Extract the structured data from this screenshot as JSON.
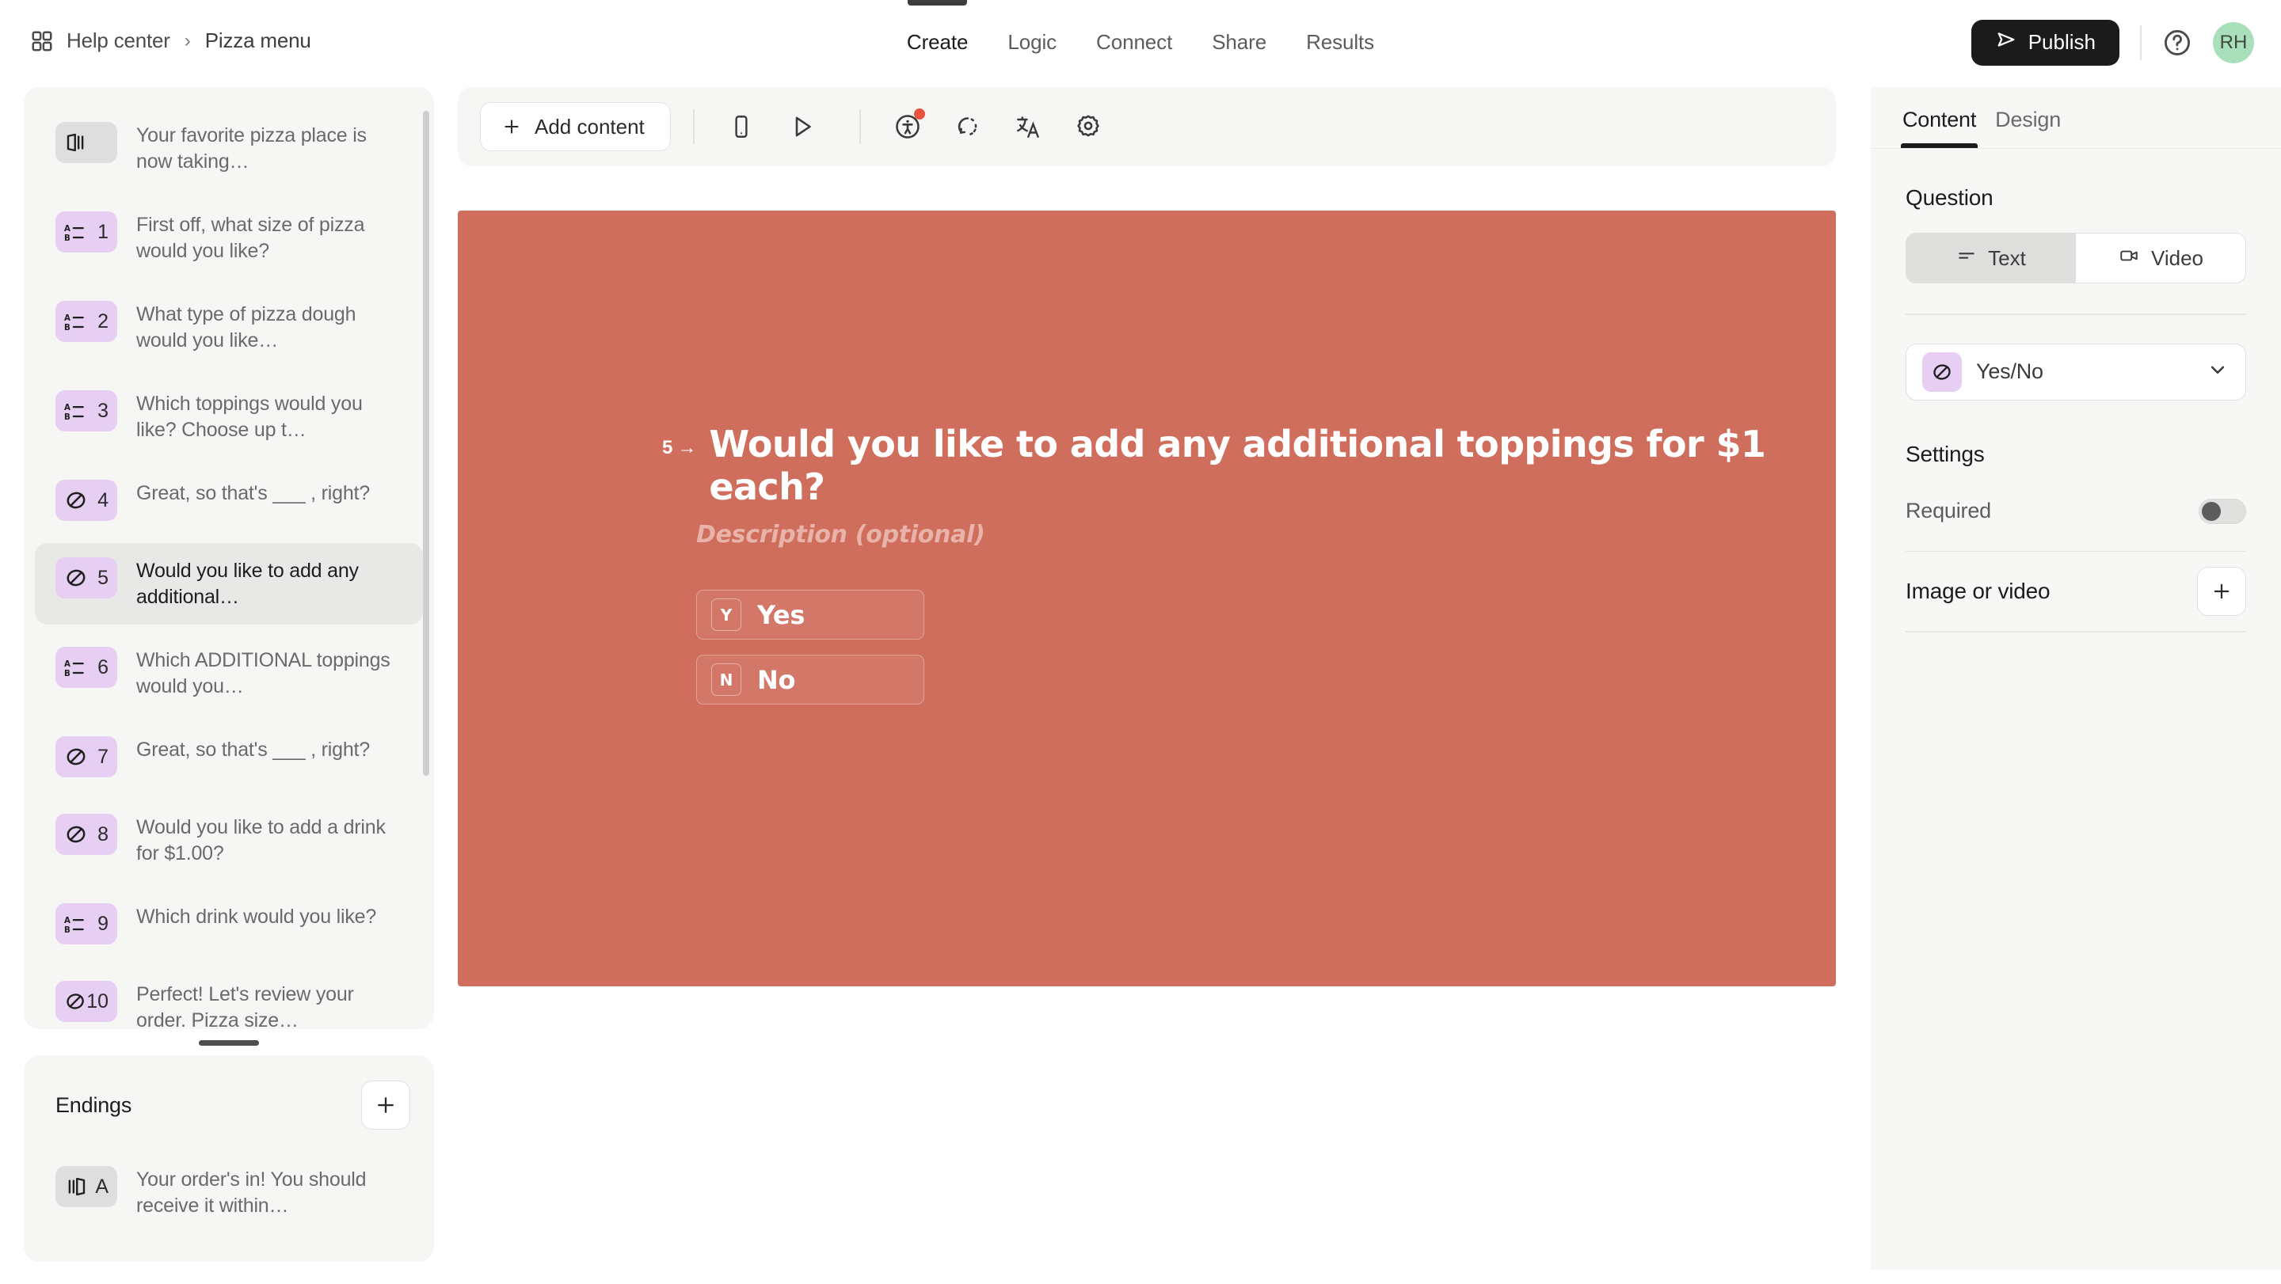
{
  "topbar": {
    "grid_icon": "grid-icon",
    "breadcrumb_root": "Help center",
    "breadcrumb_separator": "›",
    "breadcrumb_current": "Pizza menu",
    "tabs": [
      {
        "label": "Create",
        "active": true
      },
      {
        "label": "Logic",
        "active": false
      },
      {
        "label": "Connect",
        "active": false
      },
      {
        "label": "Share",
        "active": false
      },
      {
        "label": "Results",
        "active": false
      }
    ],
    "publish_label": "Publish",
    "publish_icon": "send-icon",
    "help_icon": "question-circle-icon",
    "avatar_initials": "RH",
    "avatar_color": "#a9e0bb"
  },
  "sidebar": {
    "questions": [
      {
        "badge_type": "welcome",
        "number": "",
        "label": "Your favorite pizza place is now taking…",
        "selected": false
      },
      {
        "badge_type": "multiple-choice",
        "number": "1",
        "label": "First off, what size of pizza would you like?",
        "selected": false
      },
      {
        "badge_type": "multiple-choice",
        "number": "2",
        "label": "What type of pizza dough would you like…",
        "selected": false
      },
      {
        "badge_type": "multiple-choice",
        "number": "3",
        "label": "Which toppings would you like? Choose up t…",
        "selected": false
      },
      {
        "badge_type": "yes-no",
        "number": "4",
        "label": "Great, so that's ___ , right?",
        "selected": false
      },
      {
        "badge_type": "yes-no",
        "number": "5",
        "label": "Would you like to add any additional…",
        "selected": true
      },
      {
        "badge_type": "multiple-choice",
        "number": "6",
        "label": "Which ADDITIONAL toppings would you…",
        "selected": false
      },
      {
        "badge_type": "yes-no",
        "number": "7",
        "label": "Great, so that's ___ , right?",
        "selected": false
      },
      {
        "badge_type": "yes-no",
        "number": "8",
        "label": "Would you like to add a drink for $1.00?",
        "selected": false
      },
      {
        "badge_type": "multiple-choice",
        "number": "9",
        "label": "Which drink would you like?",
        "selected": false
      },
      {
        "badge_type": "yes-no",
        "number": "10",
        "label": "Perfect! Let's review your order. Pizza size…",
        "selected": false
      }
    ],
    "endings_title": "Endings",
    "endings_add_icon": "plus-icon",
    "endings": [
      {
        "badge_type": "ending",
        "number": "A",
        "label": "Your order's in! You should receive it within…"
      }
    ]
  },
  "toolbar": {
    "add_content_label": "Add content",
    "add_content_icon": "plus-icon",
    "icons": [
      {
        "name": "mobile-preview-icon",
        "badge": false
      },
      {
        "name": "play-preview-icon",
        "badge": false
      },
      {
        "name": "accessibility-icon",
        "badge": true
      },
      {
        "name": "undo-icon",
        "badge": false
      },
      {
        "name": "translate-icon",
        "badge": false
      },
      {
        "name": "settings-gear-icon",
        "badge": false
      }
    ]
  },
  "canvas": {
    "background_color": "#d06e5e",
    "question_number": "5",
    "question_arrow": "→",
    "question_title": "Would you like to add any additional toppings for $1 each?",
    "description_placeholder": "Description (optional)",
    "choices": [
      {
        "key": "Y",
        "label": "Yes"
      },
      {
        "key": "N",
        "label": "No"
      }
    ]
  },
  "rightpanel": {
    "tabs": [
      {
        "label": "Content",
        "active": true
      },
      {
        "label": "Design",
        "active": false
      }
    ],
    "question_section_title": "Question",
    "segmented": [
      {
        "label": "Text",
        "icon": "text-lines-icon",
        "active": true
      },
      {
        "label": "Video",
        "icon": "video-camera-icon",
        "active": false
      }
    ],
    "question_type": "Yes/No",
    "question_type_icon": "yes-no-icon",
    "chevron_icon": "chevron-down-icon",
    "settings_title": "Settings",
    "required_label": "Required",
    "required_enabled": false,
    "image_or_video_label": "Image or video",
    "image_or_video_add_icon": "plus-icon"
  }
}
